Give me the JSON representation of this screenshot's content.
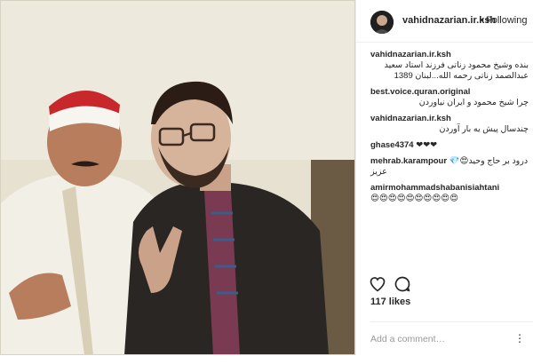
{
  "post": {
    "username": "vahidnazarian.ir.ksh",
    "separator": "•",
    "follow_status": "Following"
  },
  "comments": [
    {
      "user": "vahidnazarian.ir.ksh",
      "text": "بنده وشیخ محمود زناتی فرزند استاد سعید عبدالصمد زناتی رحمه الله...لبنان 1389"
    },
    {
      "user": "best.voice.quran.original",
      "text": "چرا شیخ محمود و ایران نیاوردن"
    },
    {
      "user": "vahidnazarian.ir.ksh",
      "text": "چندسال پیش یه بار آوردن"
    },
    {
      "user": "ghase4374",
      "text": "❤❤❤"
    },
    {
      "user": "mehrab.karampour",
      "text": "💎😍درود بر حاج وحید عزیز"
    },
    {
      "user": "amirmohammadshabanisiahtani",
      "text": "😍😍😍😍😍😍😍😍😍😍"
    }
  ],
  "actions": {
    "likes": "117 likes",
    "add_comment_placeholder": "Add a comment…",
    "more_glyph": "⋮"
  },
  "icons": {
    "heart": "heart-icon",
    "comment": "comment-icon",
    "more": "more-options-icon"
  }
}
